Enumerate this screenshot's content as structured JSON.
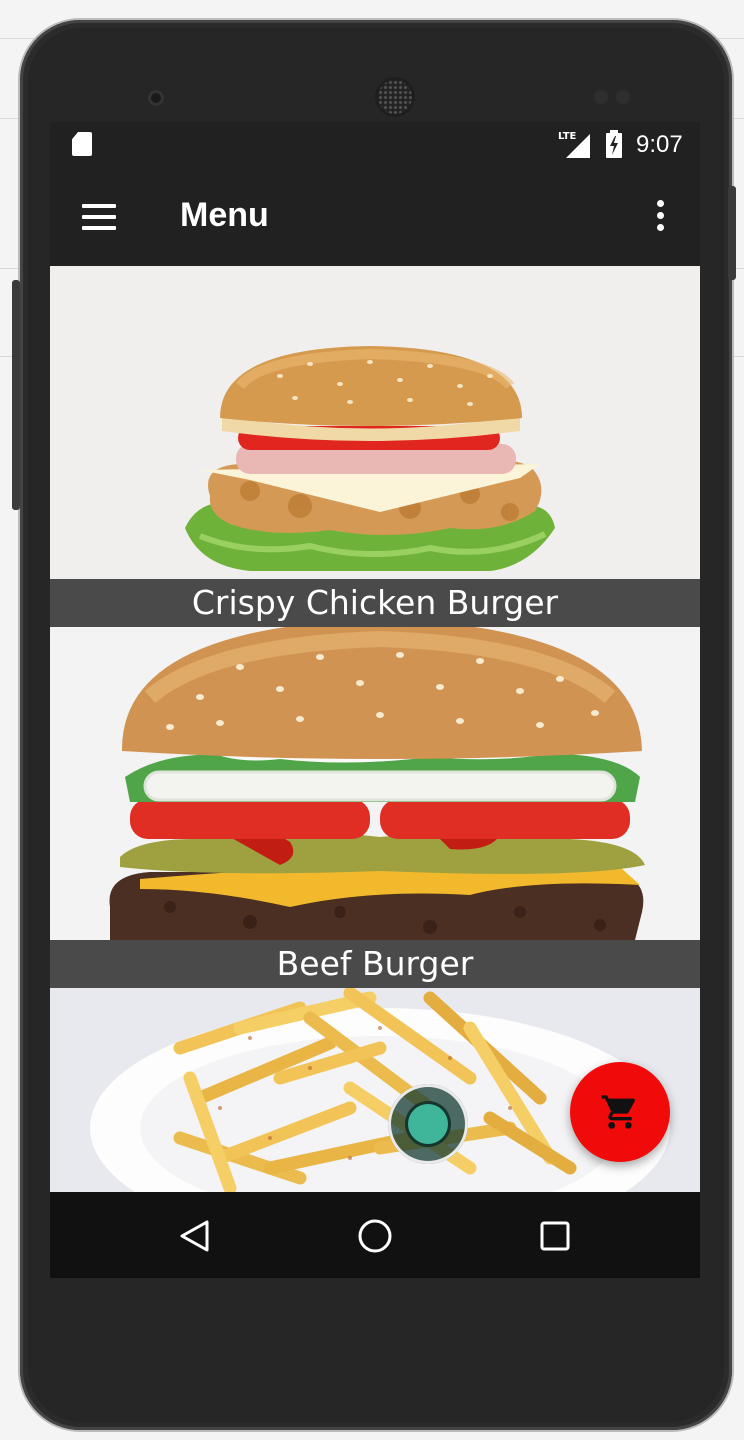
{
  "status_bar": {
    "network": "LTE",
    "time": "9:07"
  },
  "app_bar": {
    "title": "Menu",
    "menu_icon": "hamburger-menu-icon",
    "overflow_icon": "more-vert-icon"
  },
  "menu_items": [
    {
      "name": "Crispy Chicken Burger",
      "image": "crispy-chicken-burger-photo"
    },
    {
      "name": "Beef Burger",
      "image": "beef-burger-photo"
    },
    {
      "name": "",
      "image": "french-fries-photo"
    }
  ],
  "fab": {
    "icon": "shopping-cart-icon",
    "color": "#f00a0a"
  },
  "nav_bar": {
    "back_icon": "back-triangle-icon",
    "home_icon": "home-circle-icon",
    "recents_icon": "recents-square-icon"
  },
  "colors": {
    "app_bar": "#212121",
    "caption_bg": "#4a4a4a",
    "fab": "#f00a0a"
  }
}
